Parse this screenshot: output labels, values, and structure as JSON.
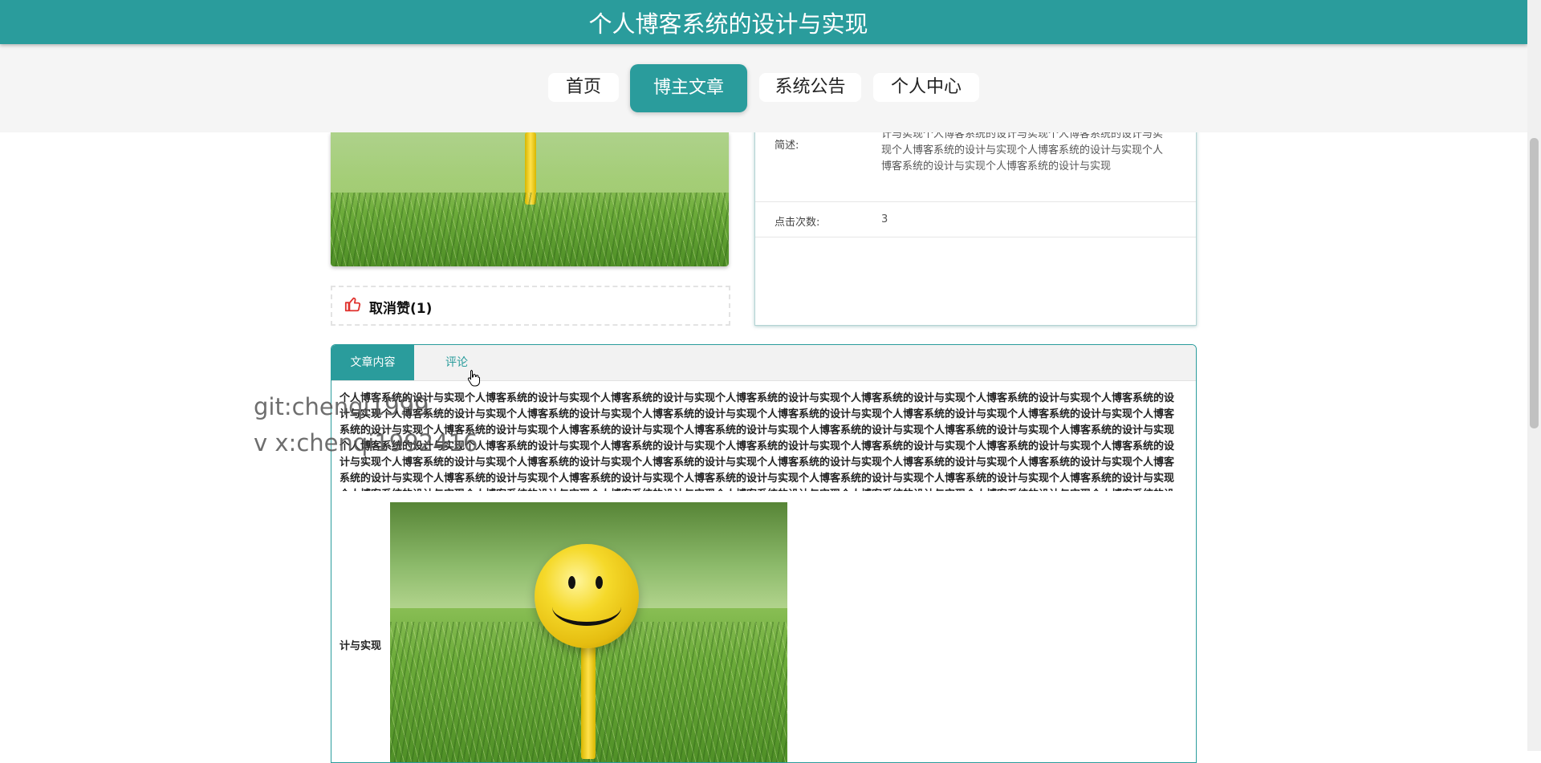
{
  "site": {
    "title": "个人博客系统的设计与实现"
  },
  "nav": [
    {
      "label": "首页",
      "active": false
    },
    {
      "label": "博主文章",
      "active": true
    },
    {
      "label": "系统公告",
      "active": false
    },
    {
      "label": "个人中心",
      "active": false
    }
  ],
  "like": {
    "label": "取消赞(1)",
    "icon": "thumbs-up-icon",
    "color": "#e0332f"
  },
  "info": {
    "summary_label": "简述:",
    "summary_value": "计与实现个人博客系统的设计与实现个人博客系统的设计与实现个人博客系统的设计与实现个人博客系统的设计与实现个人博客系统的设计与实现个人博客系统的设计与实现",
    "clicks_label": "点击次数:",
    "clicks_value": "3"
  },
  "tabs": [
    {
      "label": "文章内容",
      "active": true
    },
    {
      "label": "评论",
      "active": false
    }
  ],
  "article": {
    "text": "个人博客系统的设计与实现个人博客系统的设计与实现个人博客系统的设计与实现个人博客系统的设计与实现个人博客系统的设计与实现个人博客系统的设计与实现个人博客系统的设计与实现个人博客系统的设计与实现个人博客系统的设计与实现个人博客系统的设计与实现个人博客系统的设计与实现个人博客系统的设计与实现个人博客系统的设计与实现个人博客系统的设计与实现个人博客系统的设计与实现个人博客系统的设计与实现个人博客系统的设计与实现个人博客系统的设计与实现个人博客系统的设计与实现个人博客系统的设计与实现个人博客系统的设计与实现个人博客系统的设计与实现个人博客系统的设计与实现个人博客系统的设计与实现个人博客系统的设计与实现个人博客系统的设计与实现个人博客系统的设计与实现个人博客系统的设计与实现个人博客系统的设计与实现个人博客系统的设计与实现个人博客系统的设计与实现个人博客系统的设计与实现个人博客系统的设计与实现个人博客系统的设计与实现个人博客系统的设计与实现个人博客系统的设计与实现个人博客系统的设计与实现个人博客系统的设计与实现个人博客系统的设计与实现个人博客系统的设计与实现个人博客系统的设计与实现个人博客系统的设计与实现个人博客系统的设计与实现个人博客系统的设计与实现个人博客系统的设计与实现个人博客系统的设计与实现个人博客系统的设计与实现个人博客系统的设计与实现个人博客系统的设计与实现个人博客系统的设计与实现个人博客系统的设计与实现个人博客系统的设计与实现个人博客系统的设计与实现个人博客系统的设计与实现个人博客系统的设计与实现个人博客系统的设计与实现个人博客系统的设计与实现个人博客系统的设计与实现个人博客系统的设计与实现个人博客系统的设计与实现",
    "tail": "计与实现"
  },
  "watermark": {
    "line1": "git:chenqi1999",
    "line2": "v x:chenqi1992416"
  },
  "colors": {
    "primary": "#2a9c9c",
    "nav_bg": "#f5f5f5"
  }
}
